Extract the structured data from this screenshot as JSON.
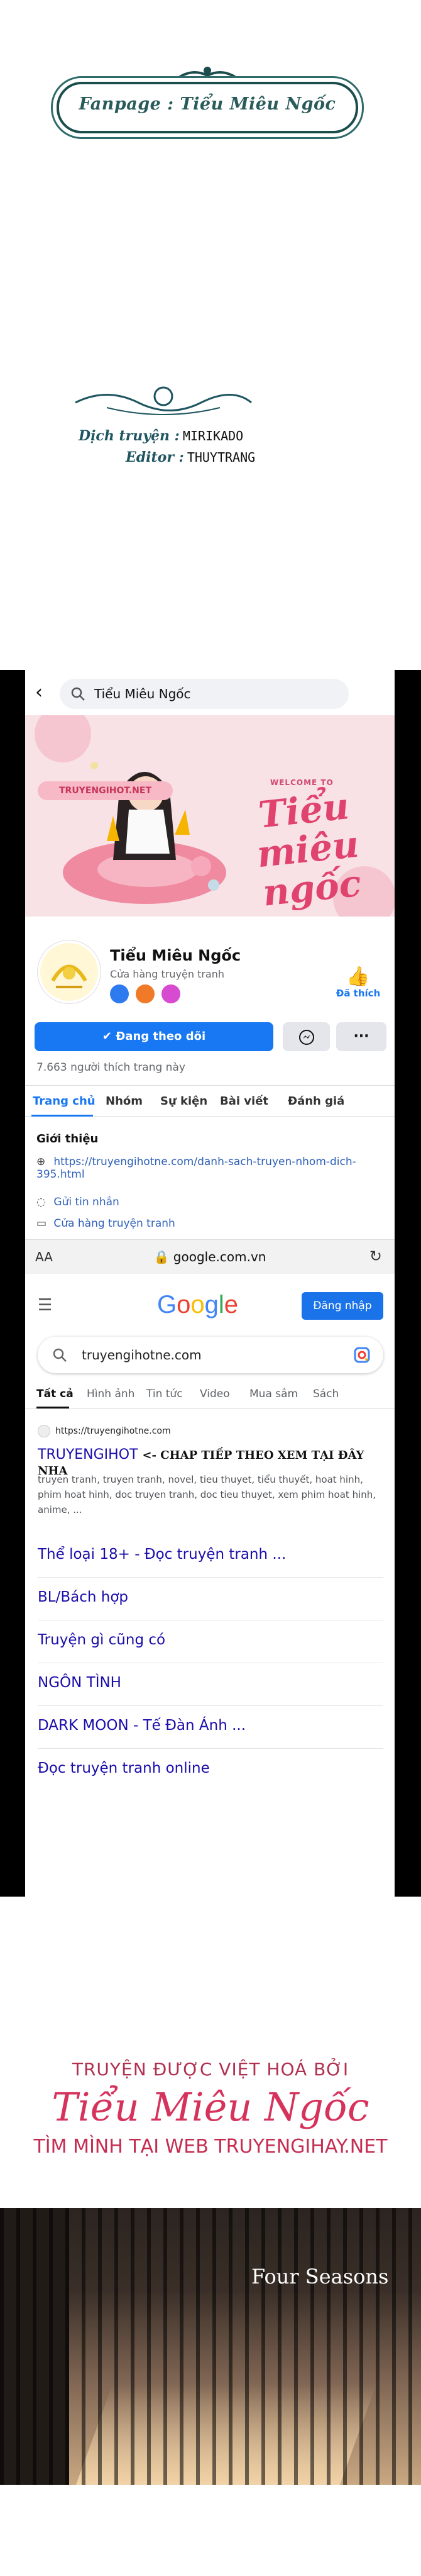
{
  "banner": {
    "text": "Fanpage : Tiểu Miêu Ngốc",
    "colors": {
      "frame": "#1b4d4d",
      "text": "#2a5b5b"
    }
  },
  "credits": {
    "translator_label": "Dịch truyện :",
    "translator_value": "MIRIKADO",
    "editor_label": "Editor :",
    "editor_value": "THUYTRANG"
  },
  "facebook": {
    "search_text": "Tiểu Miêu Ngốc",
    "cover": {
      "site": "TRUYENGIHOT.NET",
      "welcome": "WELCOME TO",
      "title": "Tiểu miêu ngốc"
    },
    "page_name": "Tiểu Miêu Ngốc",
    "category": "Cửa hàng truyện tranh",
    "liked_label": "Đã thích",
    "follow_label": "Đang theo dõi",
    "more_label": "···",
    "likes_count": "7.663 người thích trang này",
    "tabs": [
      "Trang chủ",
      "Nhóm",
      "Sự kiện",
      "Bài viết",
      "Đánh giá"
    ],
    "intro_title": "Giới thiệu",
    "intro_link": "https://truyengihotne.com/danh-sach-truyen-nhom-dich-395.html",
    "intro_message": "Gửi tin nhắn",
    "intro_category": "Cửa hàng truyện tranh",
    "accent": "#1877f2"
  },
  "safari": {
    "aa": "AA",
    "url": "google.com.vn"
  },
  "google": {
    "signin": "Đăng nhập",
    "query": "truyengihotne.com",
    "tabs": [
      "Tất cả",
      "Hình ảnh",
      "Tin tức",
      "Video",
      "Mua sắm",
      "Sách"
    ],
    "result_site": "https://truyengihotne.com",
    "result_title": "TRUYENGIHOT",
    "result_overlay": "<- CHAP TIẾP THEO XEM TẠI ĐÂY NHA",
    "result_snippet": "truyen tranh, truyen tranh, novel, tieu thuyet, tiểu thuyết, hoat hinh, phim hoat hinh, doc truyen tranh, doc tieu thuyet, xem phim hoat hinh, anime, ...",
    "sublinks": [
      "Thể loại 18+ - Đọc truyện tranh ...",
      "BL/Bách hợp",
      "Truyện gì cũng có",
      "NGÔN TÌNH",
      "DARK MOON - Tế Đàn Ánh ...",
      "Đọc truyện tranh online"
    ]
  },
  "translator_banner": {
    "line1": "TRUYỆN ĐƯỢC VIỆT HOÁ BỞI",
    "line2": "Tiểu Miêu Ngốc",
    "line3": "TÌM MÌNH TẠI WEB TRUYENGIHAY.NET",
    "color": "#d6335c"
  },
  "photo": {
    "caption": "Four Seasons"
  }
}
